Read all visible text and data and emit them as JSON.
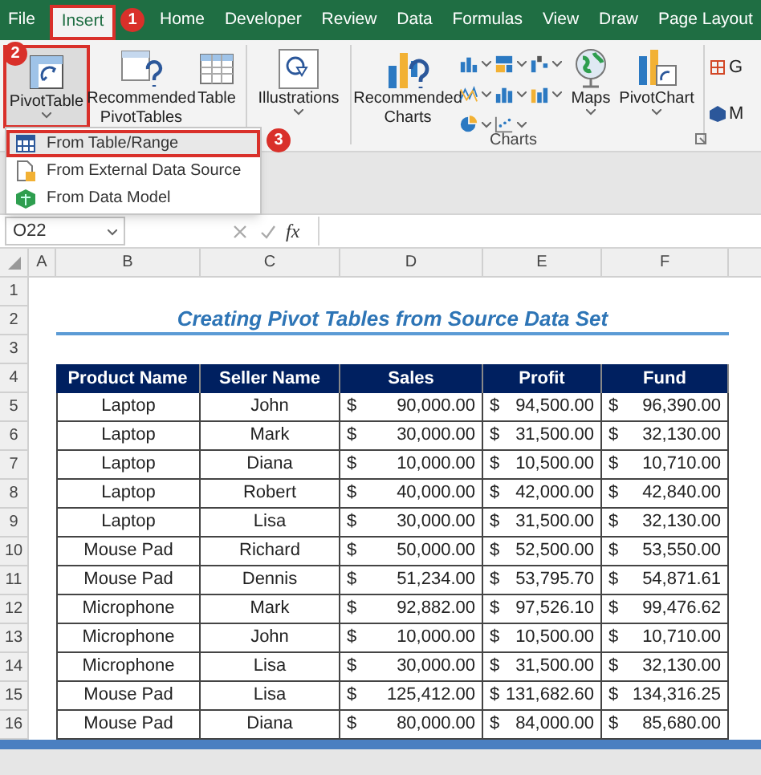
{
  "tabs": [
    {
      "label": "File",
      "selected": false
    },
    {
      "label": "Insert",
      "selected": true
    },
    {
      "label": "Home",
      "selected": false
    },
    {
      "label": "Developer",
      "selected": false
    },
    {
      "label": "Review",
      "selected": false
    },
    {
      "label": "Data",
      "selected": false
    },
    {
      "label": "Formulas",
      "selected": false
    },
    {
      "label": "View",
      "selected": false
    },
    {
      "label": "Draw",
      "selected": false
    },
    {
      "label": "Page Layout",
      "selected": false
    }
  ],
  "ribbon": {
    "buttons": [
      {
        "label": "PivotTable",
        "selected": true
      },
      {
        "label": "Recommended PivotTables",
        "selected": false
      },
      {
        "label": "Table",
        "selected": false
      },
      {
        "label": "Illustrations",
        "selected": false
      },
      {
        "label": "Recommended Charts",
        "selected": false
      },
      {
        "label": "Maps",
        "selected": false
      },
      {
        "label": "PivotChart",
        "selected": false
      }
    ],
    "group_label": "Charts",
    "cut_items": [
      "G",
      "M"
    ]
  },
  "pivot_menu": [
    {
      "label": "From Table/Range",
      "selected": true
    },
    {
      "label": "From External Data Source",
      "selected": false
    },
    {
      "label": "From Data Model",
      "selected": false
    }
  ],
  "step_badges": [
    "1",
    "2",
    "3"
  ],
  "formula_bar": {
    "name_box": "O22",
    "function_label": "fx"
  },
  "sheet": {
    "column_letters": [
      "A",
      "B",
      "C",
      "D",
      "E",
      "F"
    ],
    "row_numbers": [
      "1",
      "2",
      "3",
      "4",
      "5",
      "6",
      "7",
      "8",
      "9",
      "10",
      "11",
      "12",
      "13",
      "14",
      "15",
      "16"
    ],
    "title": "Creating Pivot Tables from Source Data Set",
    "headers": [
      "Product Name",
      "Seller Name",
      "Sales",
      "Profit",
      "Fund"
    ],
    "rows": [
      [
        "Laptop",
        "John",
        {
          "symbol": "$",
          "amount": "90,000.00"
        },
        {
          "symbol": "$",
          "amount": "94,500.00"
        },
        {
          "symbol": "$",
          "amount": "96,390.00"
        }
      ],
      [
        "Laptop",
        "Mark",
        {
          "symbol": "$",
          "amount": "30,000.00"
        },
        {
          "symbol": "$",
          "amount": "31,500.00"
        },
        {
          "symbol": "$",
          "amount": "32,130.00"
        }
      ],
      [
        "Laptop",
        "Diana",
        {
          "symbol": "$",
          "amount": "10,000.00"
        },
        {
          "symbol": "$",
          "amount": "10,500.00"
        },
        {
          "symbol": "$",
          "amount": "10,710.00"
        }
      ],
      [
        "Laptop",
        "Robert",
        {
          "symbol": "$",
          "amount": "40,000.00"
        },
        {
          "symbol": "$",
          "amount": "42,000.00"
        },
        {
          "symbol": "$",
          "amount": "42,840.00"
        }
      ],
      [
        "Laptop",
        "Lisa",
        {
          "symbol": "$",
          "amount": "30,000.00"
        },
        {
          "symbol": "$",
          "amount": "31,500.00"
        },
        {
          "symbol": "$",
          "amount": "32,130.00"
        }
      ],
      [
        "Mouse Pad",
        "Richard",
        {
          "symbol": "$",
          "amount": "50,000.00"
        },
        {
          "symbol": "$",
          "amount": "52,500.00"
        },
        {
          "symbol": "$",
          "amount": "53,550.00"
        }
      ],
      [
        "Mouse Pad",
        "Dennis",
        {
          "symbol": "$",
          "amount": "51,234.00"
        },
        {
          "symbol": "$",
          "amount": "53,795.70"
        },
        {
          "symbol": "$",
          "amount": "54,871.61"
        }
      ],
      [
        "Microphone",
        "Mark",
        {
          "symbol": "$",
          "amount": "92,882.00"
        },
        {
          "symbol": "$",
          "amount": "97,526.10"
        },
        {
          "symbol": "$",
          "amount": "99,476.62"
        }
      ],
      [
        "Microphone",
        "John",
        {
          "symbol": "$",
          "amount": "10,000.00"
        },
        {
          "symbol": "$",
          "amount": "10,500.00"
        },
        {
          "symbol": "$",
          "amount": "10,710.00"
        }
      ],
      [
        "Microphone",
        "Lisa",
        {
          "symbol": "$",
          "amount": "30,000.00"
        },
        {
          "symbol": "$",
          "amount": "31,500.00"
        },
        {
          "symbol": "$",
          "amount": "32,130.00"
        }
      ],
      [
        "Mouse Pad",
        "Lisa",
        {
          "symbol": "$",
          "amount": "125,412.00"
        },
        {
          "symbol": "$",
          "amount": "131,682.60"
        },
        {
          "symbol": "$",
          "amount": "134,316.25"
        }
      ],
      [
        "Mouse Pad",
        "Diana",
        {
          "symbol": "$",
          "amount": "80,000.00"
        },
        {
          "symbol": "$",
          "amount": "84,000.00"
        },
        {
          "symbol": "$",
          "amount": "85,680.00"
        }
      ]
    ]
  }
}
